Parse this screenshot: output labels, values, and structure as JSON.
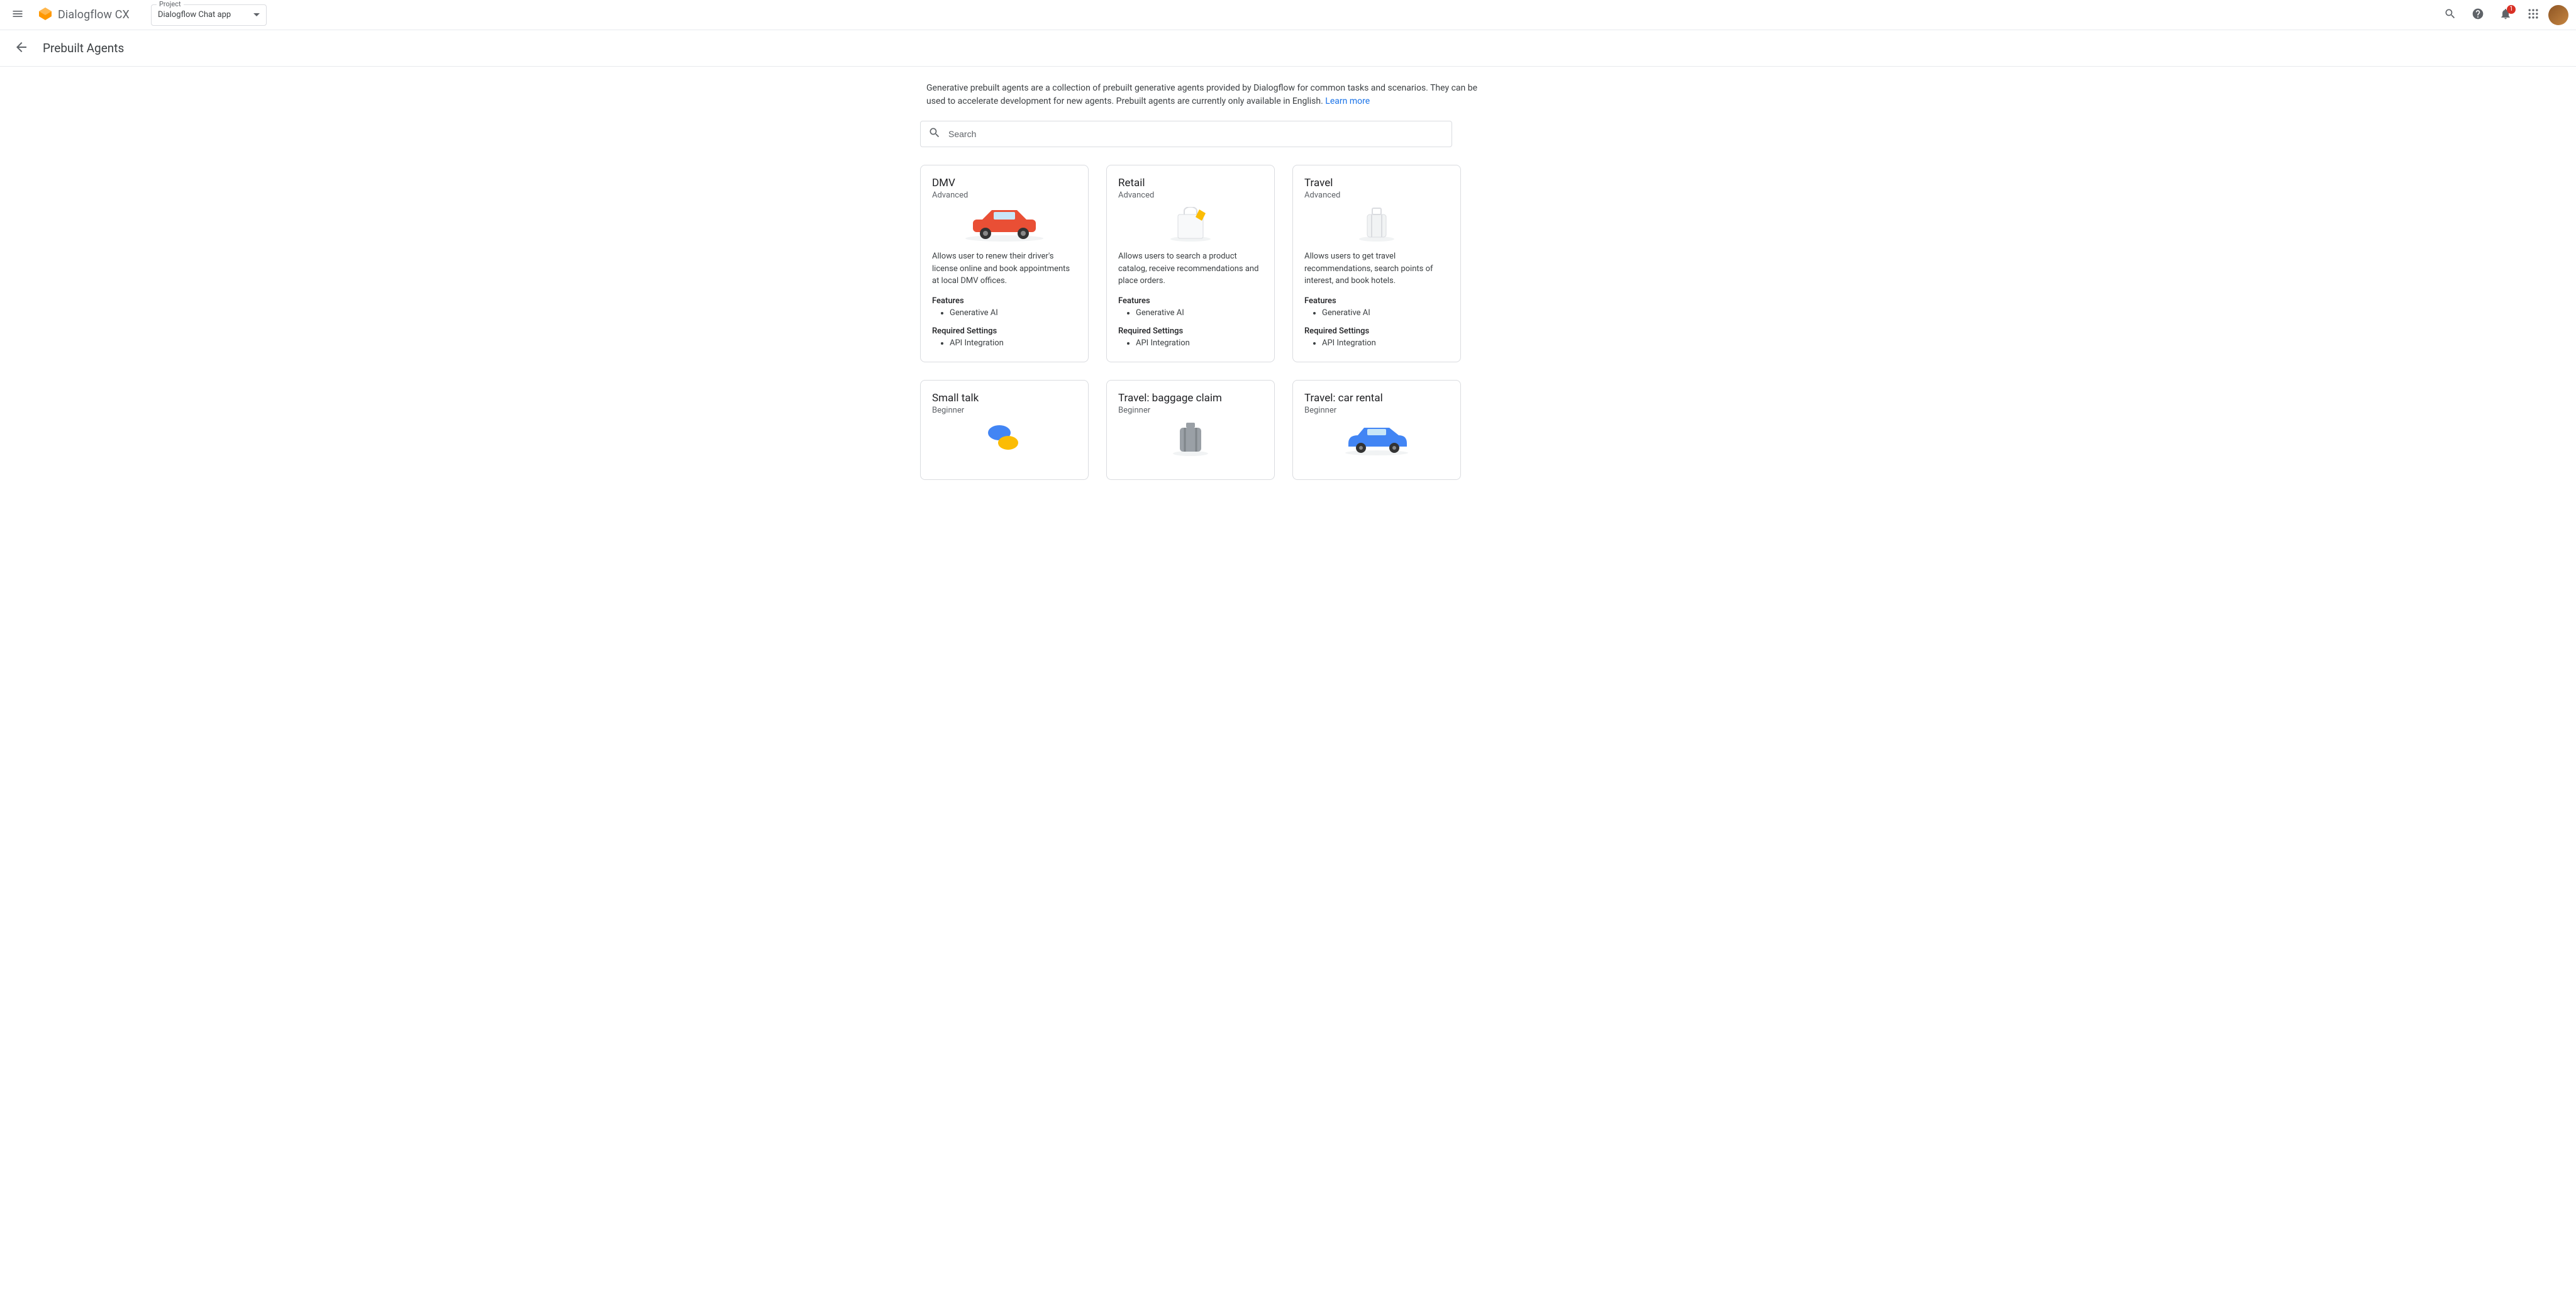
{
  "top": {
    "brand": "Dialogflow CX",
    "project_label": "Project",
    "project_value": "Dialogflow Chat app",
    "notif_badge": "1"
  },
  "header": {
    "title": "Prebuilt Agents"
  },
  "intro": {
    "text": "Generative prebuilt agents are a collection of prebuilt generative agents provided by Dialogflow for common tasks and scenarios. They can be used to accelerate development for new agents. Prebuilt agents are currently only available in English. ",
    "link_text": "Learn more"
  },
  "search": {
    "placeholder": "Search"
  },
  "labels": {
    "features": "Features",
    "required_settings": "Required Settings"
  },
  "cards": [
    {
      "title": "DMV",
      "level": "Advanced",
      "desc": "Allows user to renew their driver's license online and book appointments at local DMV offices.",
      "features": [
        "Generative AI"
      ],
      "required": [
        "API Integration"
      ]
    },
    {
      "title": "Retail",
      "level": "Advanced",
      "desc": "Allows users to search a product catalog, receive recommendations and place orders.",
      "features": [
        "Generative AI"
      ],
      "required": [
        "API Integration"
      ]
    },
    {
      "title": "Travel",
      "level": "Advanced",
      "desc": "Allows users to get travel recommendations, search points of interest, and book hotels.",
      "features": [
        "Generative AI"
      ],
      "required": [
        "API Integration"
      ]
    },
    {
      "title": "Small talk",
      "level": "Beginner"
    },
    {
      "title": "Travel: baggage claim",
      "level": "Beginner"
    },
    {
      "title": "Travel: car rental",
      "level": "Beginner"
    }
  ]
}
